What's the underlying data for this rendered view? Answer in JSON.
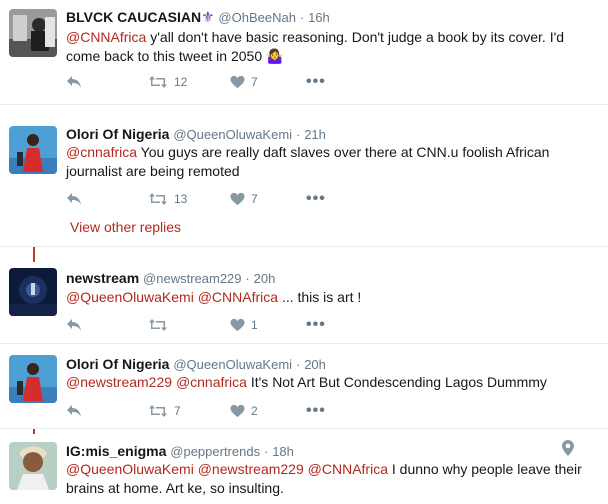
{
  "tweets": [
    {
      "name": "BLVCK CAUCASIAN",
      "badge": "⚜",
      "handle": "@OhBeeNah",
      "time": "16h",
      "mentions": [
        "@CNNAfrica"
      ],
      "text": " y'all don't have basic reasoning. Don't judge a book by its cover. I'd come back to this tweet in 2050 🤷‍♀️",
      "retweets": "12",
      "likes": "7"
    },
    {
      "name": "Olori Of Nigeria",
      "handle": "@QueenOluwaKemi",
      "time": "21h",
      "mentions": [
        "@cnnafrica"
      ],
      "text": " You guys are really daft slaves over there at CNN.u foolish African journalist are being remoted",
      "retweets": "13",
      "likes": "7",
      "view_replies": "View other replies"
    },
    {
      "name": "newstream",
      "handle": "@newstream229",
      "time": "20h",
      "mentions": [
        "@QueenOluwaKemi",
        "@CNNAfrica"
      ],
      "text": " ... this is art !",
      "retweets": "",
      "likes": "1"
    },
    {
      "name": "Olori Of Nigeria",
      "handle": "@QueenOluwaKemi",
      "time": "20h",
      "mentions": [
        "@newstream229",
        "@cnnafrica"
      ],
      "text": " It's Not Art But Condescending Lagos Dummmy",
      "retweets": "7",
      "likes": "2"
    },
    {
      "name": "IG:mis_enigma",
      "handle": "@peppertrends",
      "time": "18h",
      "mentions": [
        "@QueenOluwaKemi",
        "@newstream229",
        "@CNNAfrica"
      ],
      "text": " I dunno why people leave their brains at home. Art ke, so insulting."
    }
  ],
  "separator": "·",
  "icons": {
    "reply": "reply-icon",
    "retweet": "retweet-icon",
    "like": "heart-icon",
    "more": "more-icon",
    "location": "location-pin-icon"
  },
  "colors": {
    "accent": "#b5281d",
    "muted": "#657786",
    "thread_line": "#c0392b"
  }
}
